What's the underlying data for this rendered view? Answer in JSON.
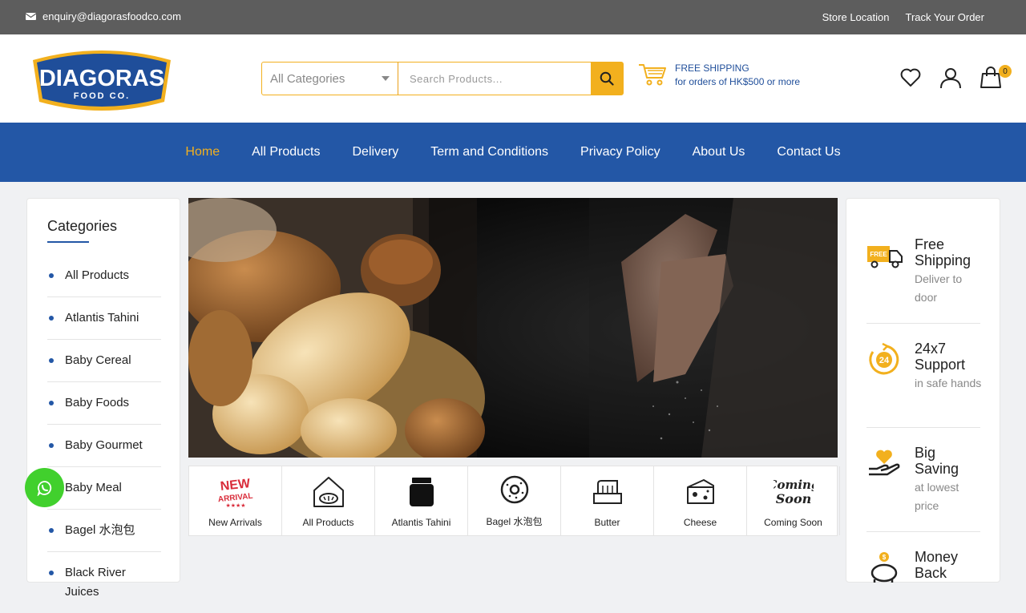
{
  "topbar": {
    "email": "enquiry@diagorasfoodco.com",
    "links": [
      "Store Location",
      "Track Your Order"
    ]
  },
  "header": {
    "logo_text": "DIAGORAS",
    "logo_sub": "FOOD CO.",
    "category_select": "All Categories",
    "search_placeholder": "Search Products...",
    "shipping_title": "FREE SHIPPING",
    "shipping_sub": "for orders of HK$500 or more",
    "cart_count": "0",
    "icons": [
      "heart-icon",
      "user-icon",
      "bag-icon"
    ]
  },
  "nav": {
    "items": [
      "Home",
      "All Products",
      "Delivery",
      "Term and Conditions",
      "Privacy Policy",
      "About Us",
      "Contact Us"
    ],
    "active": "Home"
  },
  "sidebar": {
    "title": "Categories",
    "items": [
      "All Products",
      "Atlantis Tahini",
      "Baby Cereal",
      "Baby Foods",
      "Baby Gourmet",
      "Baby Meal",
      "Bagel 水泡包",
      "Black River Juices"
    ]
  },
  "strip": {
    "items": [
      "New Arrivals",
      "All Products",
      "Atlantis Tahini",
      "Bagel 水泡包",
      "Butter",
      "Cheese",
      "Coming Soon"
    ]
  },
  "features": [
    {
      "title": "Free Shipping",
      "sub": "Deliver to door"
    },
    {
      "title": "24x7 Support",
      "sub": "in safe hands"
    },
    {
      "title": "Big Saving",
      "sub": "at lowest price"
    },
    {
      "title": "Money Back",
      "sub": ""
    }
  ],
  "colors": {
    "brand_blue": "#2357a6",
    "accent": "#f2b01e",
    "topbar": "#5d5d5d",
    "whatsapp": "#41d02d"
  }
}
